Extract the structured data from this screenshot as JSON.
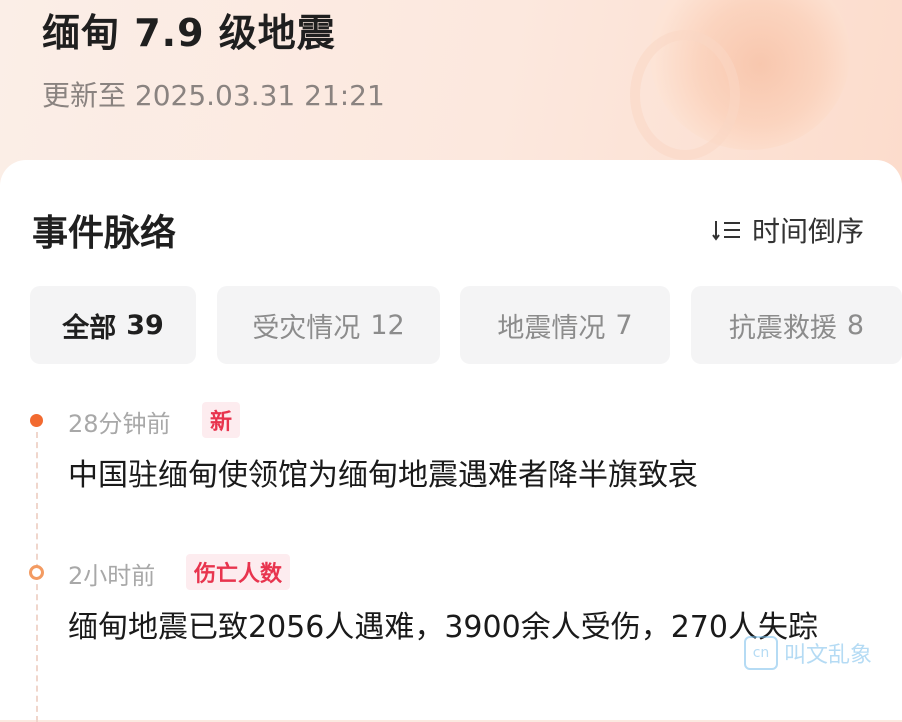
{
  "header": {
    "title": "缅甸 7.9 级地震",
    "update_time": "更新至 2025.03.31 21:21"
  },
  "section": {
    "title": "事件脉络",
    "sort_label": "时间倒序",
    "sort_icon": "sort-descending-icon"
  },
  "tabs": [
    {
      "label": "全部",
      "count": "39",
      "active": true
    },
    {
      "label": "受灾情况",
      "count": "12",
      "active": false
    },
    {
      "label": "地震情况",
      "count": "7",
      "active": false
    },
    {
      "label": "抗震救援",
      "count": "8",
      "active": false
    }
  ],
  "timeline": [
    {
      "time": "28分钟前",
      "tag": "新",
      "text": "中国驻缅甸使领馆为缅甸地震遇难者降半旗致哀",
      "dot": "filled"
    },
    {
      "time": "2小时前",
      "tag": "伤亡人数",
      "text": "缅甸地震已致2056人遇难，3900余人受伤，270人失踪",
      "dot": "hollow"
    }
  ],
  "watermark": {
    "text": "叫文乱象",
    "icon_text": "cn"
  },
  "colors": {
    "accent": "#f26a30",
    "tag_red": "#e8344e",
    "tag_bg": "#fdecef",
    "tab_bg": "#f4f4f5"
  }
}
